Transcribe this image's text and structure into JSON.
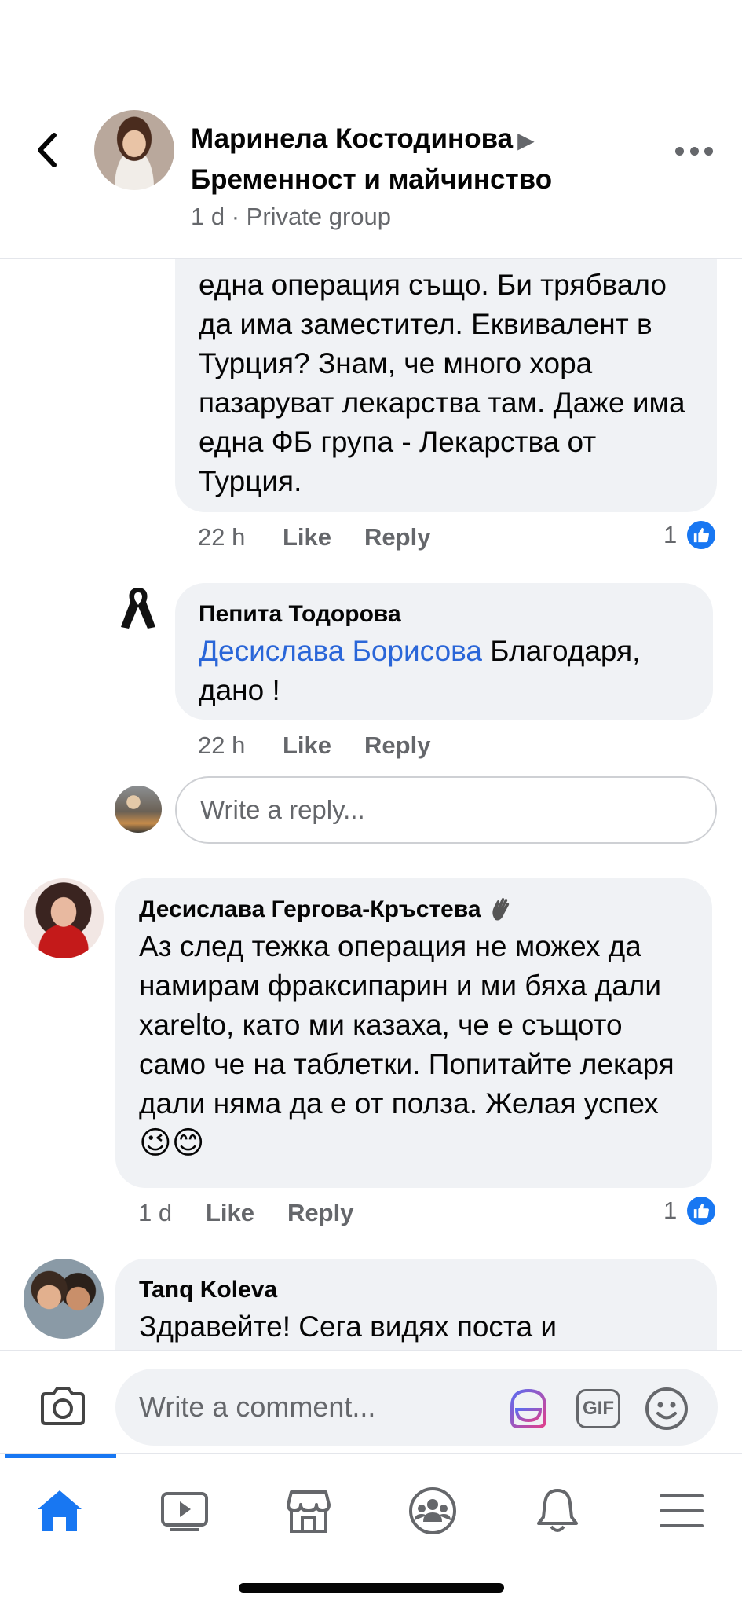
{
  "header": {
    "author": "Маринела Костодинова",
    "arrow": "▶",
    "group": "Бременност и майчинство",
    "meta": "1 d · Private group"
  },
  "comment1": {
    "text": "една операция също. Би трябвало да има заместител. Еквивалент в Турция? Знам, че много хора пазаруват лекарства там. Даже има една ФБ група - Лекарства от Турция.",
    "time": "22 h",
    "like_label": "Like",
    "reply_label": "Reply",
    "like_count": "1"
  },
  "comment2": {
    "author": "Пепита Тодорова",
    "mention": "Десислава Борисова",
    "text": " Благодаря, дано !",
    "time": "22 h",
    "like_label": "Like",
    "reply_label": "Reply"
  },
  "reply_input": {
    "placeholder": "Write a reply..."
  },
  "comment3": {
    "author": "Десислава Гергова-Кръстева",
    "text": "Аз след тежка операция не можех да намирам фраксипарин и ми бяха дали xarelto,  като ми казаха, че е същото само че на таблетки. Попитайте лекаря дали няма да е от полза. Желая успех",
    "emoji": "😉😊",
    "time": "1 d",
    "like_label": "Like",
    "reply_label": "Reply",
    "like_count": "1"
  },
  "comment4": {
    "author": "Tanq Koleva",
    "text": "Здравейте! Сега видях поста и"
  },
  "composer": {
    "placeholder": "Write a comment...",
    "gif_label": "GIF"
  },
  "colors": {
    "accent": "#1877f2",
    "bubble": "#f0f2f5",
    "secondary_text": "#65676b",
    "mention": "#2a66d8"
  },
  "icons": [
    "back-chevron-icon",
    "more-icon",
    "black-ribbon-icon",
    "wave-icon",
    "like-icon",
    "camera-icon",
    "avatar-sticker-icon",
    "gif-icon",
    "emoji-icon",
    "home-icon",
    "watch-icon",
    "marketplace-icon",
    "groups-icon",
    "bell-icon",
    "menu-icon"
  ]
}
